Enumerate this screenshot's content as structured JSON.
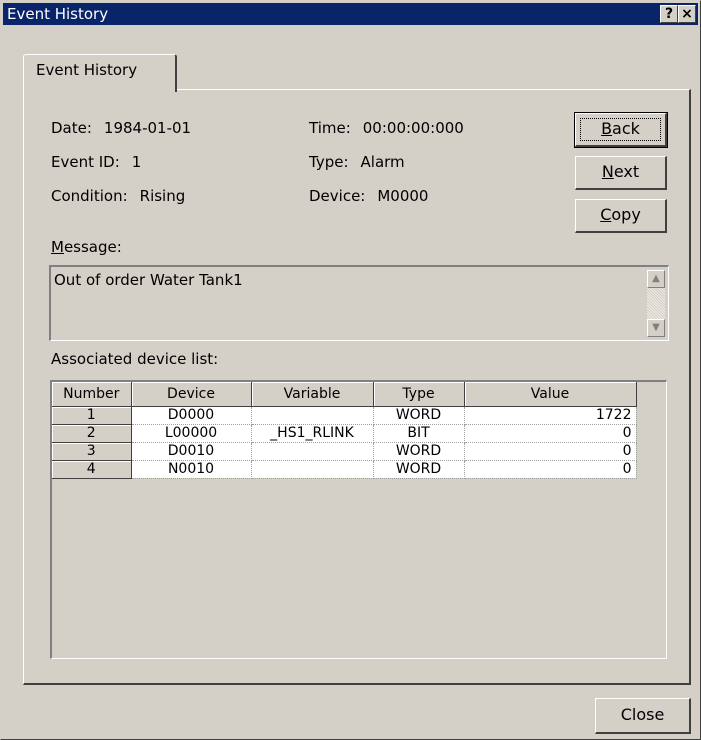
{
  "window": {
    "title": "Event History",
    "help_label": "?",
    "close_label": "×",
    "tab_label": "Event History"
  },
  "event": {
    "date_label": "Date:",
    "date_value": "1984-01-01",
    "time_label": "Time:",
    "time_value": "00:00:00:000",
    "event_id_label": "Event ID:",
    "event_id_value": "1",
    "type_label": "Type:",
    "type_value": "Alarm",
    "condition_label": "Condition:",
    "condition_value": "Rising",
    "device_label": "Device:",
    "device_value": "M0000"
  },
  "buttons": {
    "back": {
      "mnemonic": "B",
      "rest": "ack"
    },
    "next": {
      "mnemonic": "N",
      "rest": "ext"
    },
    "copy": {
      "mnemonic": "C",
      "rest": "opy"
    },
    "close": "Close"
  },
  "message": {
    "label_mnemonic": "M",
    "label_rest": "essage:",
    "text": "Out of order Water Tank1"
  },
  "device_list": {
    "label": "Associated device list:",
    "columns": [
      "Number",
      "Device",
      "Variable",
      "Type",
      "Value"
    ],
    "rows": [
      {
        "number": "1",
        "device": "D0000",
        "variable": "",
        "type": "WORD",
        "value": "1722"
      },
      {
        "number": "2",
        "device": "L00000",
        "variable": "_HS1_RLINK",
        "type": "BIT",
        "value": "0"
      },
      {
        "number": "3",
        "device": "D0010",
        "variable": "",
        "type": "WORD",
        "value": "0"
      },
      {
        "number": "4",
        "device": "N0010",
        "variable": "",
        "type": "WORD",
        "value": "0"
      }
    ]
  }
}
